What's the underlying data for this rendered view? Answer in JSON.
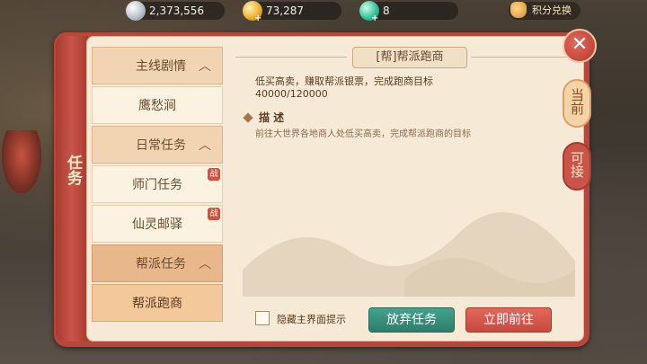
{
  "currencies": {
    "silver": {
      "value": "2,373,556",
      "icon": "silver-coin-icon"
    },
    "gold": {
      "value": "73,287",
      "icon": "gold-coin-icon"
    },
    "jade": {
      "value": "8",
      "icon": "jade-gem-icon"
    },
    "exchange_label": "积分兑换"
  },
  "panel": {
    "spine_title": "任务"
  },
  "task_list": [
    {
      "label": "主线剧情",
      "kind": "category",
      "expanded": true
    },
    {
      "label": "鹰愁涧",
      "kind": "task"
    },
    {
      "label": "日常任务",
      "kind": "category",
      "expanded": true
    },
    {
      "label": "师门任务",
      "kind": "task",
      "badge": "战"
    },
    {
      "label": "仙灵邮驿",
      "kind": "task",
      "badge": "战"
    },
    {
      "label": "帮派任务",
      "kind": "category",
      "expanded": true,
      "active": true
    },
    {
      "label": "帮派跑商",
      "kind": "task",
      "selected": true
    }
  ],
  "detail": {
    "title": "[帮]帮派跑商",
    "goal": "低买高卖，赚取帮派银票，完成跑商目标",
    "progress": "40000/120000",
    "desc_heading": "描 述",
    "description": "前往大世界各地商人处低买高卖，完成帮派跑商的目标"
  },
  "controls": {
    "hide_hint_label": "隐藏主界面提示",
    "hide_hint_checked": false,
    "abandon_label": "放弃任务",
    "go_label": "立即前往"
  },
  "tabs": {
    "current": "当前",
    "accept": "可接"
  },
  "colors": {
    "frame": "#b9463b",
    "accent_green": "#2f7d6c",
    "accent_red": "#c64a3e"
  }
}
